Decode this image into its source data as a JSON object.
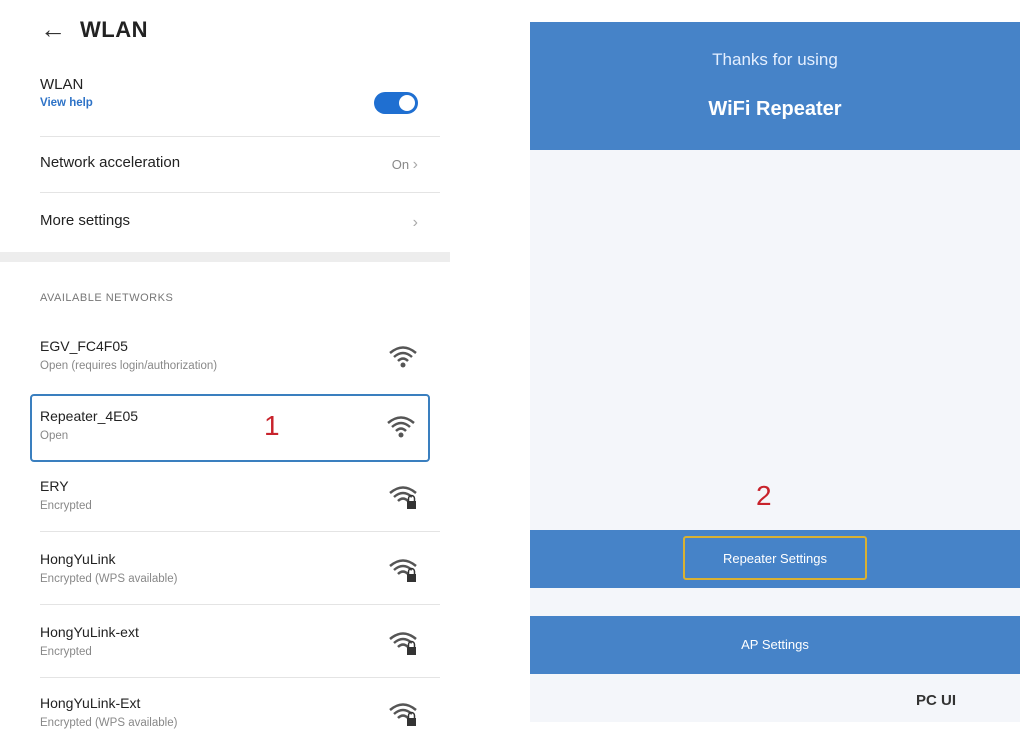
{
  "header": {
    "back_icon": "arrow-left-icon",
    "title": "WLAN"
  },
  "wlan": {
    "label": "WLAN",
    "help_link": "View help",
    "toggle_on": true
  },
  "settings": [
    {
      "label": "Network acceleration",
      "value": "On"
    },
    {
      "label": "More settings",
      "value": ""
    }
  ],
  "available_networks": {
    "title": "AVAILABLE NETWORKS",
    "items": [
      {
        "ssid": "EGV_FC4F05",
        "status": "Open (requires login/authorization)",
        "icon": "wifi-icon"
      },
      {
        "ssid": "Repeater_4E05",
        "status": "Open",
        "icon": "wifi-icon"
      },
      {
        "ssid": "ERY",
        "status": "Encrypted",
        "icon": "wifi-lock-icon"
      },
      {
        "ssid": "HongYuLink",
        "status": "Encrypted (WPS available)",
        "icon": "wifi-lock-icon"
      },
      {
        "ssid": "HongYuLink-ext",
        "status": "Encrypted",
        "icon": "wifi-lock-icon"
      },
      {
        "ssid": "HongYuLink-Ext",
        "status": "Encrypted (WPS available)",
        "icon": "wifi-lock-icon"
      }
    ]
  },
  "annotations": {
    "step1": "1",
    "step2": "2"
  },
  "repeater_app": {
    "thanks": "Thanks for using",
    "title": "WiFi Repeater",
    "repeater_settings_button": "Repeater Settings",
    "ap_settings_button": "AP Settings",
    "pc_ui_link": "PC UI"
  },
  "colors": {
    "accent_blue": "#4683c8",
    "toggle_blue": "#1f6fd1",
    "highlight_yellow": "#d9b132",
    "annotation_red": "#c8232c"
  }
}
